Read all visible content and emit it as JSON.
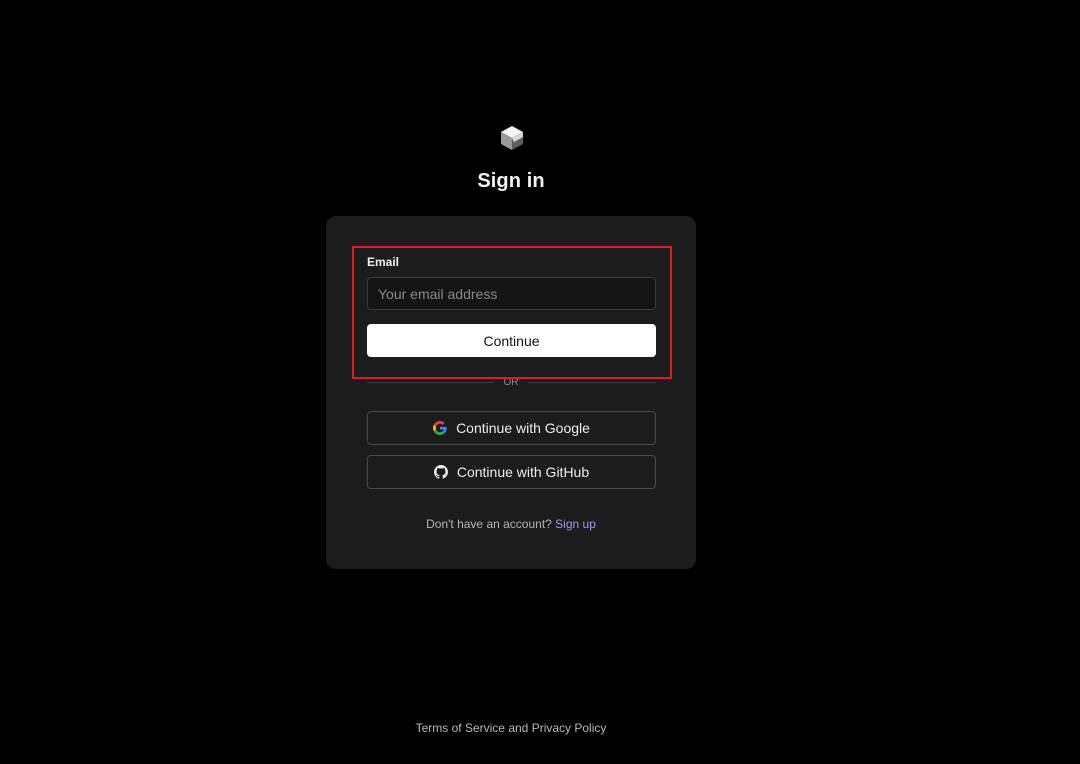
{
  "page": {
    "title": "Sign in"
  },
  "logo": {
    "icon": "cube-logo-icon"
  },
  "form": {
    "email_label": "Email",
    "email_placeholder": "Your email address",
    "email_value": "",
    "continue_label": "Continue",
    "divider_text": "OR"
  },
  "oauth": {
    "google_label": "Continue with Google",
    "google_icon": "google-icon",
    "github_label": "Continue with GitHub",
    "github_icon": "github-icon"
  },
  "signup": {
    "prompt": "Don't have an account?",
    "link_label": "Sign up"
  },
  "footer": {
    "terms_label": "Terms of Service",
    "joiner": "and",
    "privacy_label": "Privacy Policy"
  },
  "colors": {
    "background": "#000000",
    "card": "#1c1c1c",
    "highlight": "#d81e1e",
    "link": "#a896f0",
    "primary_button": "#ffffff"
  }
}
